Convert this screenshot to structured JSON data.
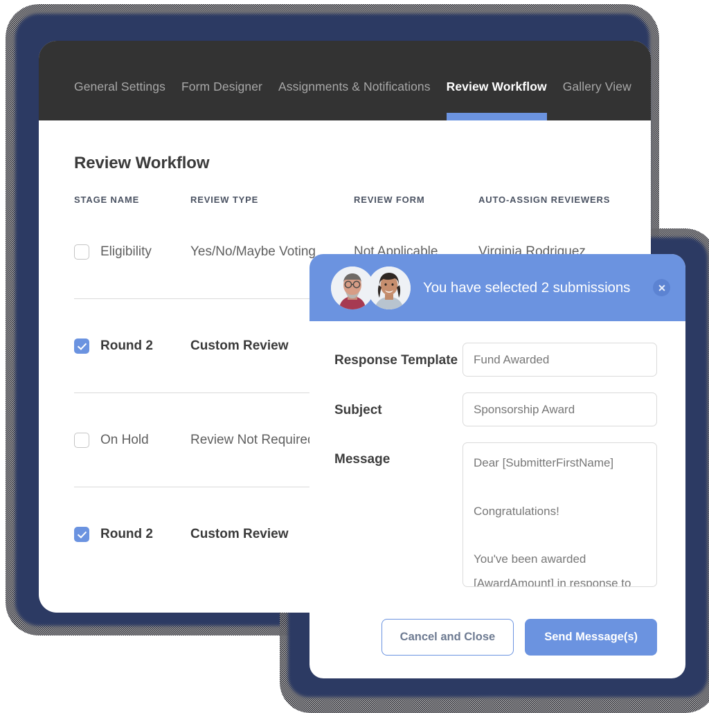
{
  "theme": {
    "accent": "#6b93e0",
    "frame": "#2c3a63",
    "tabbar_bg": "#333333",
    "text_dark": "#3a3a3a",
    "text_muted": "#777777"
  },
  "tabs": [
    {
      "label": "General Settings",
      "active": false
    },
    {
      "label": "Form Designer",
      "active": false
    },
    {
      "label": "Assignments & Notifications",
      "active": false
    },
    {
      "label": "Review Workflow",
      "active": true
    },
    {
      "label": "Gallery View",
      "active": false
    }
  ],
  "page": {
    "title": "Review Workflow"
  },
  "table": {
    "columns": [
      "STAGE NAME",
      "REVIEW TYPE",
      "REVIEW FORM",
      "AUTO-ASSIGN REVIEWERS"
    ],
    "rows": [
      {
        "checked": false,
        "stage_name": "Eligibility",
        "review_type": "Yes/No/Maybe Voting",
        "review_form": "Not Applicable",
        "reviewers": "Virginia Rodriguez"
      },
      {
        "checked": true,
        "stage_name": "Round 2",
        "review_type": "Custom Review",
        "review_form": "",
        "reviewers": ""
      },
      {
        "checked": false,
        "stage_name": "On Hold",
        "review_type": "Review Not Required",
        "review_form": "",
        "reviewers": ""
      },
      {
        "checked": true,
        "stage_name": "Round 2",
        "review_type": "Custom Review",
        "review_form": "",
        "reviewers": ""
      }
    ]
  },
  "modal": {
    "title": "You have selected 2 submissions",
    "close_icon": "close-icon",
    "avatars": [
      {
        "name": "avatar-man"
      },
      {
        "name": "avatar-woman"
      }
    ],
    "fields": {
      "response_template": {
        "label": "Response Template",
        "value": "Fund Awarded",
        "placeholder": "Fund Awarded"
      },
      "subject": {
        "label": "Subject",
        "value": "Sponsorship Award",
        "placeholder": "Sponsorship Award"
      },
      "message": {
        "label": "Message",
        "value": "Dear [SubmitterFirstName]\n\nCongratulations!\n\nYou've been awarded [AwardAmount] in response to your request.",
        "placeholder": "Dear [SubmitterFirstName]"
      }
    },
    "buttons": {
      "cancel": "Cancel and Close",
      "send": "Send Message(s)"
    }
  }
}
